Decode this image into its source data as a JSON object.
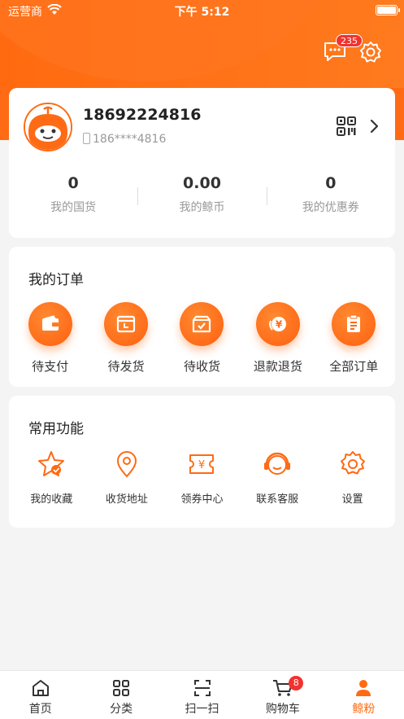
{
  "status_bar": {
    "carrier": "运营商",
    "time": "下午 5:12"
  },
  "header": {
    "message_badge": "235"
  },
  "profile": {
    "username": "18692224816",
    "phone_masked": "186****4816",
    "stats": [
      {
        "value": "0",
        "label": "我的国货"
      },
      {
        "value": "0.00",
        "label": "我的鲸币"
      },
      {
        "value": "0",
        "label": "我的优惠券"
      }
    ]
  },
  "orders": {
    "title": "我的订单",
    "items": [
      {
        "label": "待支付",
        "icon": "wallet-icon"
      },
      {
        "label": "待发货",
        "icon": "shipment-icon"
      },
      {
        "label": "待收货",
        "icon": "package-check-icon"
      },
      {
        "label": "退款退货",
        "icon": "refund-icon"
      },
      {
        "label": "全部订单",
        "icon": "clipboard-icon"
      }
    ]
  },
  "functions": {
    "title": "常用功能",
    "items": [
      {
        "label": "我的收藏",
        "icon": "star-icon"
      },
      {
        "label": "收货地址",
        "icon": "location-pin-icon"
      },
      {
        "label": "领券中心",
        "icon": "coupon-icon"
      },
      {
        "label": "联系客服",
        "icon": "headset-icon"
      },
      {
        "label": "设置",
        "icon": "gear-icon"
      }
    ]
  },
  "tabbar": {
    "items": [
      {
        "label": "首页",
        "icon": "home-icon"
      },
      {
        "label": "分类",
        "icon": "grid-icon"
      },
      {
        "label": "扫一扫",
        "icon": "scan-icon"
      },
      {
        "label": "购物车",
        "icon": "cart-icon",
        "badge": "8"
      },
      {
        "label": "鲸粉",
        "icon": "user-icon",
        "active": true
      }
    ]
  },
  "colors": {
    "accent": "#ff6a14",
    "badge": "#f2322e",
    "background": "#f4f4f4"
  }
}
